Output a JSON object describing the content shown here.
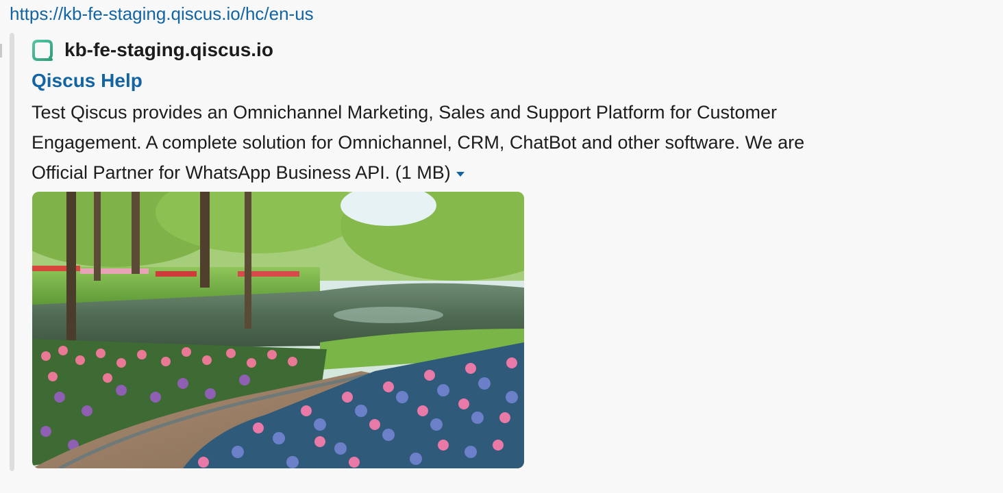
{
  "message": {
    "url": "https://kb-fe-staging.qiscus.io/hc/en-us"
  },
  "attachment": {
    "site_name": "kb-fe-staging.qiscus.io",
    "site_icon": "qiscus-chat-bubble-icon",
    "title": "Qiscus Help",
    "description": "Test Qiscus provides an Omnichannel Marketing, Sales and Support Platform for Customer Engagement. A complete solution for Omnichannel, CRM, ChatBot and other software. We are Official Partner for WhatsApp Business API.",
    "size_label": "(1 MB)",
    "toggle_icon": "caret-down-icon",
    "preview_image": "tulip-garden-lake-photo"
  },
  "colors": {
    "link": "#1264a3",
    "icon_green": "#3fb68b",
    "text": "#1d1c1d"
  }
}
